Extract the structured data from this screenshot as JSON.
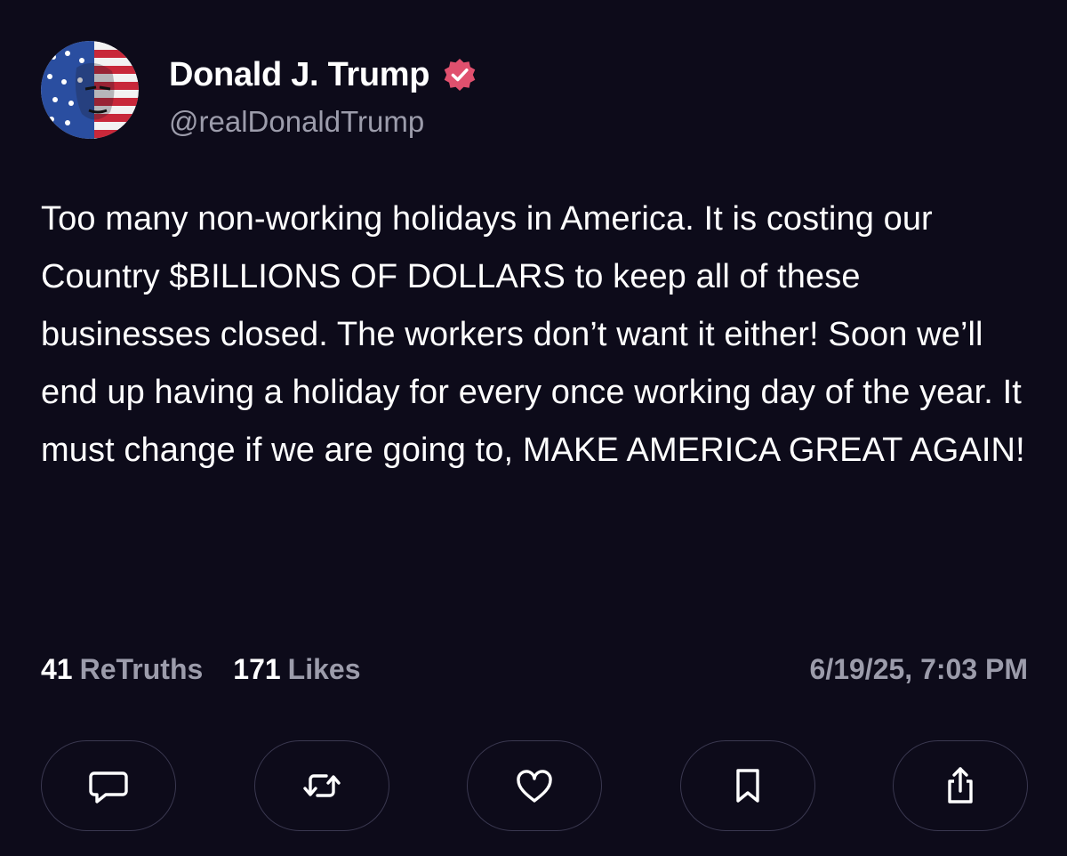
{
  "post": {
    "author": {
      "display_name": "Donald J. Trump",
      "handle": "@realDonaldTrump",
      "verified": true,
      "verified_badge_color": "#e0506e",
      "avatar_icon": "stars-and-stripes-portrait-avatar"
    },
    "body": "Too many non-working holidays in America. It is costing our Country $BILLIONS OF DOLLARS to keep all of these businesses closed. The workers don’t want it either! Soon we’ll end up having a holiday for every once working day of the year. It must change if we are going to, MAKE AMERICA GREAT AGAIN!",
    "stats": {
      "retruths_count": "41",
      "retruths_label": "ReTruths",
      "likes_count": "171",
      "likes_label": "Likes"
    },
    "timestamp": "6/19/25, 7:03 PM",
    "actions": [
      {
        "name": "reply",
        "icon": "speech-bubble-icon"
      },
      {
        "name": "retruth",
        "icon": "repost-arrows-icon"
      },
      {
        "name": "like",
        "icon": "heart-icon"
      },
      {
        "name": "bookmark",
        "icon": "bookmark-icon"
      },
      {
        "name": "share",
        "icon": "share-upload-icon"
      }
    ]
  },
  "colors": {
    "background": "#0d0b1a",
    "primary_text": "#ffffff",
    "secondary_text": "#9c9cab",
    "button_border": "#3a3850"
  }
}
